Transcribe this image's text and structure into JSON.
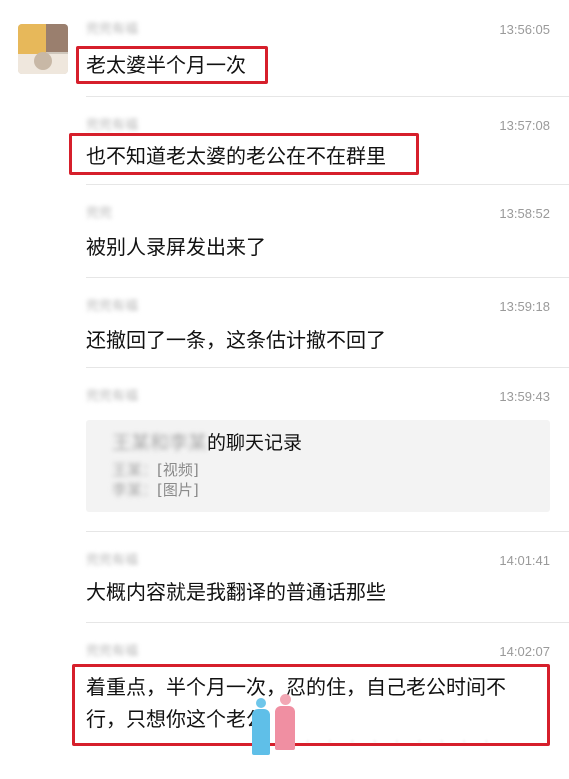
{
  "messages": [
    {
      "sender": "兜兜有福",
      "time": "13:56:05",
      "text": "老太婆半个月一次"
    },
    {
      "sender": "兜兜有福",
      "time": "13:57:08",
      "text": "也不知道老太婆的老公在不在群里"
    },
    {
      "sender": "兜兜",
      "time": "13:58:52",
      "text": "被别人录屏发出来了"
    },
    {
      "sender": "兜兜有福",
      "time": "13:59:18",
      "text": "还撤回了一条，这条估计撤不回了"
    },
    {
      "sender": "兜兜有福",
      "time": "13:59:43",
      "card": {
        "title_blur": "王某和李某",
        "title": "的聊天记录",
        "lines": [
          {
            "name_blur": "王某：",
            "value": "[视频]"
          },
          {
            "name_blur": "李某：",
            "value": "[图片]"
          }
        ]
      }
    },
    {
      "sender": "兜兜有福",
      "time": "14:01:41",
      "text": "大概内容就是我翻译的普通话那些"
    },
    {
      "sender": "兜兜有福",
      "time": "14:02:07",
      "text_line1": "着重点，半个月一次，忍的住，自己老公时间不",
      "text_line2": "行，只想你这个老公"
    }
  ],
  "colors": {
    "highlight": "#d61f2b",
    "divider": "#e6e6e6",
    "card_bg": "#f3f3f3"
  },
  "watermark": {
    "dots": "· · · · · · · · ·"
  }
}
